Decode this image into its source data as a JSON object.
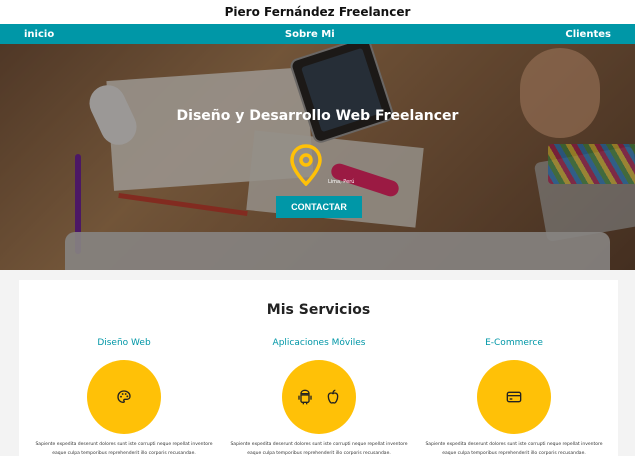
{
  "site": {
    "title": "Piero Fernández Freelancer"
  },
  "nav": {
    "items": [
      "inicio",
      "Sobre Mi",
      "Clientes"
    ]
  },
  "hero": {
    "title": "Diseño y Desarrollo Web Freelancer",
    "location": "Lima, Perú",
    "cta": "CONTACTAR"
  },
  "services": {
    "heading": "Mis Servicios",
    "items": [
      {
        "title": "Diseño Web",
        "icon": "palette-icon",
        "text1": "Sapiente expedita deserunt dolores sunt iste corrupti neque repellat inventore",
        "text2": "eaque culpa temporibus reprehenderit illo corporis recusandae."
      },
      {
        "title": "Aplicaciones Móviles",
        "icon": "android-icon apple-icon",
        "text1": "Sapiente expedita deserunt dolores sunt iste corrupti neque repellat inventore",
        "text2": "eaque culpa temporibus reprehenderit illo corporis recusandae."
      },
      {
        "title": "E-Commerce",
        "icon": "credit-card-icon",
        "text1": "Sapiente expedita deserunt dolores sunt iste corrupti neque repellat inventore",
        "text2": "eaque culpa temporibus reprehenderit illo corporis recusandae."
      }
    ]
  },
  "colors": {
    "accent": "#0097a7",
    "circle": "#ffc107",
    "pin": "#ffc107"
  }
}
